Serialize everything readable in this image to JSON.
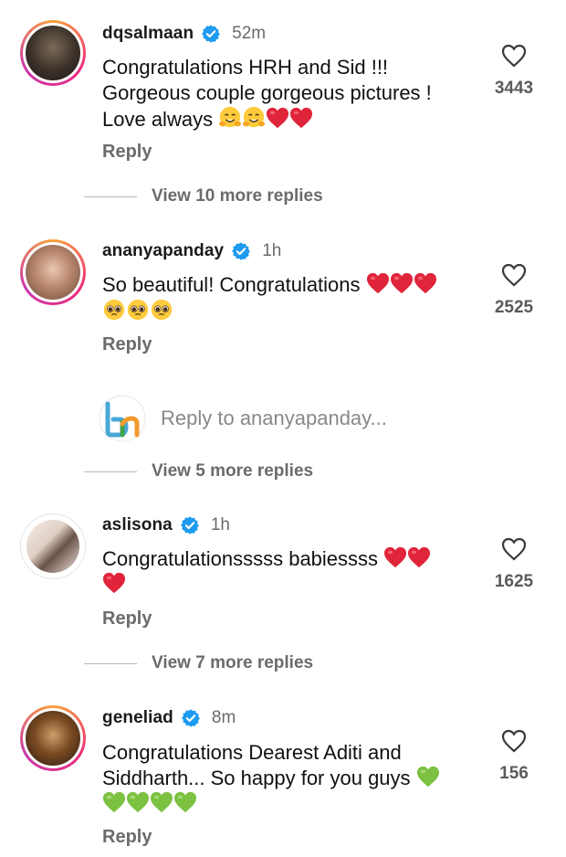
{
  "comments": [
    {
      "username": "dqsalmaan",
      "time": "52m",
      "lines": [
        "Congratulations HRH and Sid !!!",
        "Gorgeous couple gorgeous pictures !",
        "Love always"
      ],
      "likes": "3443",
      "reply_label": "Reply",
      "view_replies": "View 10 more replies"
    },
    {
      "username": "ananyapanday",
      "time": "1h",
      "lines": [
        "So beautiful! Congratulations"
      ],
      "likes": "2525",
      "reply_label": "Reply",
      "view_replies": "View 5 more replies"
    },
    {
      "username": "aslisona",
      "time": "1h",
      "lines": [
        "Congratulationsssss babiessss"
      ],
      "likes": "1625",
      "reply_label": "Reply",
      "view_replies": "View 7 more replies"
    },
    {
      "username": "geneliad",
      "time": "8m",
      "lines": [
        "Congratulations Dearest Aditi and",
        "Siddharth... So happy for you guys"
      ],
      "likes": "156",
      "reply_label": "Reply"
    }
  ],
  "reply_to": {
    "text": "Reply to ananyapanday..."
  },
  "colors": {
    "verified": "#1d9bf0",
    "heart_red": "#e0243a",
    "heart_green": "#7cc142",
    "muted": "#6b6b6b"
  },
  "icons": [
    "verified-icon",
    "like-heart-icon",
    "red-heart-emoji",
    "green-heart-emoji",
    "hugging-face-emoji",
    "pleading-face-emoji",
    "bh-logo"
  ]
}
